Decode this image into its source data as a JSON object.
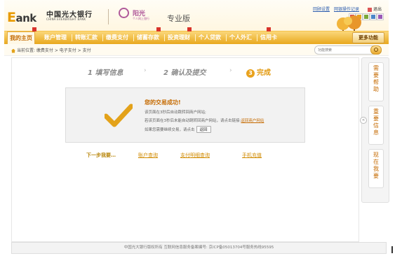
{
  "header": {
    "logo_prefix": "E",
    "logo_suffix": "ank",
    "bank_name_cn": "中国光大银行",
    "bank_name_en": "CHINA EVERBRIGHT BANK",
    "sunshine_name": "阳光",
    "sunshine_sub": "个人网上银行",
    "edition": "专业版",
    "links": [
      "回顾设置",
      "网银操作记录"
    ],
    "exit_label": "退出",
    "swatches": [
      "#d9534f",
      "#e8a21d",
      "#7aa83a",
      "#4a86c8",
      "#9b59b6"
    ]
  },
  "nav": {
    "items": [
      {
        "label": "我的主页",
        "active": true
      },
      {
        "label": "账户管理"
      },
      {
        "label": "转账汇款"
      },
      {
        "label": "缴费支付"
      },
      {
        "label": "储蓄存款",
        "badge": "N"
      },
      {
        "label": "投资理财",
        "badge": "N"
      },
      {
        "label": "个人贷款"
      },
      {
        "label": "个人外汇"
      },
      {
        "label": "信用卡",
        "badge": "N"
      }
    ],
    "more_label": "更多功能"
  },
  "breadcrumb": "当前位置: 缴费支付 > 电子支付 > 支付",
  "search": {
    "placeholder": "功能搜索"
  },
  "steps": [
    {
      "num": "1",
      "label": "填写信息"
    },
    {
      "num": "2",
      "label": "确认及提交"
    },
    {
      "num": "3",
      "label": "完成"
    }
  ],
  "result": {
    "title": "您的交易成功!",
    "line1": "该页面在3秒后自动跳转回商户网站;",
    "line2_prefix": "若该页面在3秒后未能自动跳转回商户网站，请点击链接:",
    "line2_link": "返回商户网站",
    "line3_prefix": "如果您需要继续交易，请点击",
    "return_button": "返回"
  },
  "actions": {
    "next_label": "下一步我要…",
    "items": [
      "账户查询",
      "支付明细查询",
      "手机充值"
    ]
  },
  "side": {
    "buttons": [
      "需要帮助",
      "重要信息",
      "现在我要"
    ],
    "toggle": "<"
  },
  "footer": "中国光大银行版权所有 互联网信息服务备案编号: 京ICP备05013704号服务热线95595"
}
